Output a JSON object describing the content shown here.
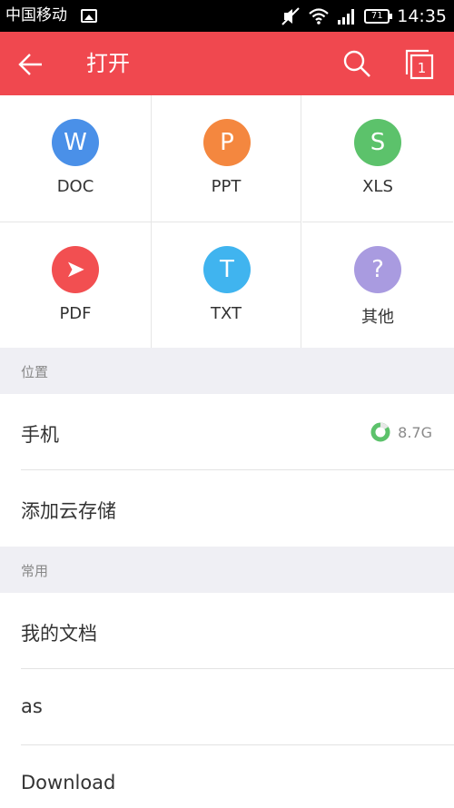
{
  "status_bar": {
    "carrier": "中国移动",
    "time": "14:35",
    "battery": "71"
  },
  "app_bar": {
    "title": "打开",
    "tab_count": "1"
  },
  "file_types": [
    {
      "label": "DOC",
      "glyph": "W",
      "color": "#4a90e8"
    },
    {
      "label": "PPT",
      "glyph": "P",
      "color": "#f4873f"
    },
    {
      "label": "XLS",
      "glyph": "S",
      "color": "#5cc26b"
    },
    {
      "label": "PDF",
      "glyph": "➤",
      "color": "#f24f51"
    },
    {
      "label": "TXT",
      "glyph": "T",
      "color": "#40b4ef"
    },
    {
      "label": "其他",
      "glyph": "?",
      "color": "#a99be0"
    }
  ],
  "location": {
    "header": "位置",
    "phone_label": "手机",
    "phone_storage": "8.7G",
    "add_cloud_label": "添加云存储"
  },
  "common": {
    "header": "常用",
    "items": [
      "我的文档",
      "as",
      "Download"
    ]
  },
  "colors": {
    "accent": "#f0484f",
    "storage_ring": "#5cc26b"
  }
}
